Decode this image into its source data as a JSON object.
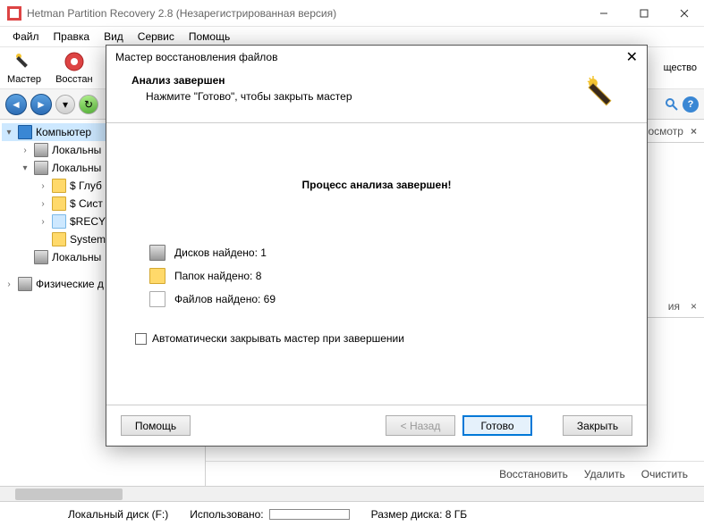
{
  "window": {
    "title": "Hetman Partition Recovery 2.8 (Незарегистрированная версия)"
  },
  "menu": {
    "file": "Файл",
    "edit": "Правка",
    "view": "Вид",
    "service": "Сервис",
    "help": "Помощь"
  },
  "toolbar": {
    "wizard": "Мастер",
    "recover": "Восстан",
    "trailing": "щество"
  },
  "tree": {
    "computer": "Компьютер",
    "local1": "Локальны",
    "local2": "Локальны",
    "deep": "$ Глуб",
    "sys": "$ Сист",
    "recy": "$RECY",
    "system": "System",
    "local3": "Локальны",
    "physical": "Физические д"
  },
  "tabs": {
    "view_label": "осмотр",
    "side_label": "ия"
  },
  "actions": {
    "restore": "Восстановить",
    "delete": "Удалить",
    "clear": "Очистить"
  },
  "status": {
    "disk_label": "Локальный диск (F:)",
    "used_label": "Использовано:",
    "size_label": "Размер диска: 8 ГБ"
  },
  "dialog": {
    "title": "Мастер восстановления файлов",
    "heading": "Анализ завершен",
    "sub": "Нажмите \"Готово\", чтобы закрыть мастер",
    "result": "Процесс анализа завершен!",
    "disks": "Дисков найдено: 1",
    "folders": "Папок найдено: 8",
    "files": "Файлов найдено: 69",
    "autoclose": "Автоматически закрывать мастер при завершении",
    "help": "Помощь",
    "back": "< Назад",
    "done": "Готово",
    "close": "Закрыть"
  }
}
